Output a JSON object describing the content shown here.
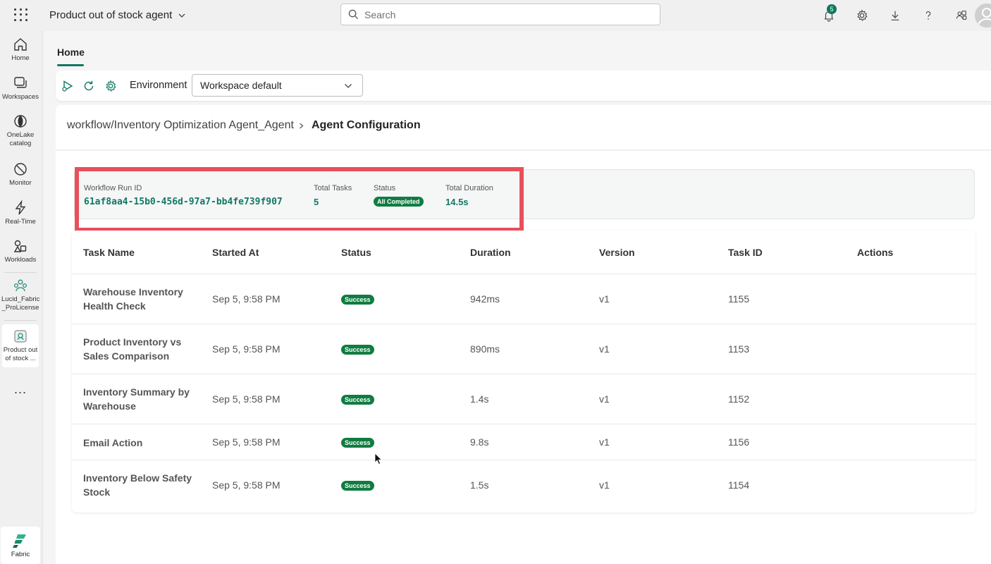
{
  "topbar": {
    "app_title": "Product out of stock agent",
    "search_placeholder": "Search",
    "notification_count": "5"
  },
  "leftrail": {
    "items": [
      {
        "label": "Home",
        "icon": "home-icon"
      },
      {
        "label": "Workspaces",
        "icon": "workspaces-icon"
      },
      {
        "label": "OneLake catalog",
        "icon": "onelake-icon"
      },
      {
        "label": "Monitor",
        "icon": "monitor-icon"
      },
      {
        "label": "Real-Time",
        "icon": "lightning-icon"
      },
      {
        "label": "Workloads",
        "icon": "workloads-icon"
      },
      {
        "label": "Lucid_Fabric _ProLicense",
        "icon": "workspace-people-icon"
      },
      {
        "label": "Product out of stock ...",
        "icon": "agent-item-icon"
      }
    ],
    "more": "...",
    "fabric_label": "Fabric"
  },
  "main": {
    "tab_home": "Home",
    "toolbar": {
      "environment_label": "Environment",
      "environment_value": "Workspace default"
    },
    "breadcrumb": {
      "path": "workflow/Inventory Optimization Agent_Agent",
      "current": "Agent Configuration"
    },
    "summary": {
      "run_id_label": "Workflow Run ID",
      "run_id": "61af8aa4-15b0-456d-97a7-bb4fe739f907",
      "total_tasks_label": "Total Tasks",
      "total_tasks": "5",
      "status_label": "Status",
      "status": "All Completed",
      "duration_label": "Total Duration",
      "duration": "14.5s"
    },
    "table": {
      "headers": [
        "Task Name",
        "Started At",
        "Status",
        "Duration",
        "Version",
        "Task ID",
        "Actions"
      ],
      "rows": [
        {
          "name": "Warehouse Inventory Health Check",
          "started": "Sep 5, 9:58 PM",
          "status": "Success",
          "duration": "942ms",
          "version": "v1",
          "task_id": "1155"
        },
        {
          "name": "Product Inventory vs Sales Comparison",
          "started": "Sep 5, 9:58 PM",
          "status": "Success",
          "duration": "890ms",
          "version": "v1",
          "task_id": "1153"
        },
        {
          "name": "Inventory Summary by Warehouse",
          "started": "Sep 5, 9:58 PM",
          "status": "Success",
          "duration": "1.4s",
          "version": "v1",
          "task_id": "1152"
        },
        {
          "name": "Email Action",
          "started": "Sep 5, 9:58 PM",
          "status": "Success",
          "duration": "9.8s",
          "version": "v1",
          "task_id": "1156"
        },
        {
          "name": "Inventory Below Safety Stock",
          "started": "Sep 5, 9:58 PM",
          "status": "Success",
          "duration": "1.5s",
          "version": "v1",
          "task_id": "1154"
        }
      ]
    }
  },
  "colors": {
    "accent": "#117865",
    "success": "#107c41",
    "highlight": "#e8505b"
  }
}
